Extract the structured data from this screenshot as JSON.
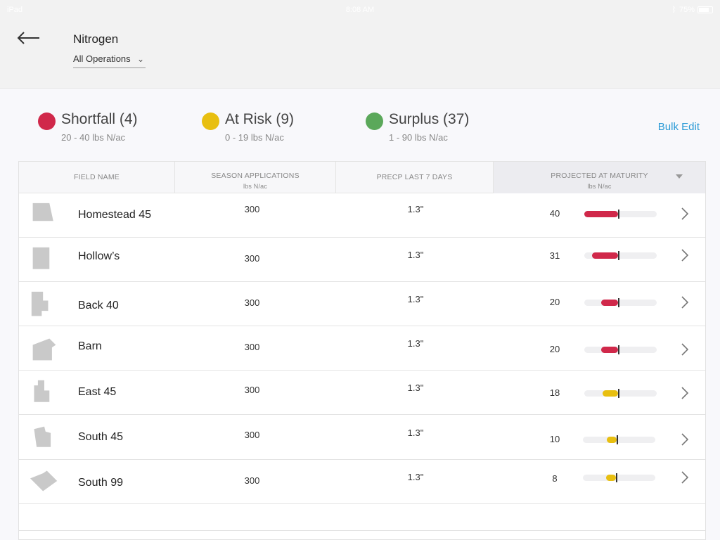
{
  "status_bar": {
    "carrier": "iPad",
    "time": "8:08 AM",
    "battery": "75%"
  },
  "header": {
    "title": "Nitrogen",
    "operations_select": "All Operations"
  },
  "summary": {
    "items": [
      {
        "label": "Shortfall (4)",
        "range": "20 - 40 lbs N/ac",
        "color": "#d0284a"
      },
      {
        "label": "At Risk (9)",
        "range": "0 - 19 lbs N/ac",
        "color": "#e8bf10"
      },
      {
        "label": "Surplus (37)",
        "range": "1 - 90  lbs N/ac",
        "color": "#5ba85a"
      }
    ],
    "bulk_edit": "Bulk Edit"
  },
  "table": {
    "columns": [
      {
        "label": "FIELD NAME",
        "sub": ""
      },
      {
        "label": "SEASON APPLICATIONS",
        "sub": "lbs N/ac"
      },
      {
        "label": "PRECP LAST 7 DAYS",
        "sub": ""
      },
      {
        "label": "PROJECTED AT MATURITY",
        "sub": "lbs N/ac"
      }
    ],
    "rows": [
      {
        "name": "Homestead 45",
        "season": "300",
        "precip": "1.3\"",
        "projected": "40",
        "status": "shortfall",
        "shape": "homestead"
      },
      {
        "name": "Hollow’s",
        "season": "300",
        "precip": "1.3\"",
        "projected": "31",
        "status": "shortfall",
        "shape": "hollows"
      },
      {
        "name": "Back 40",
        "season": "300",
        "precip": "1.3\"",
        "projected": "20",
        "status": "shortfall",
        "shape": "back40"
      },
      {
        "name": "Barn",
        "season": "300",
        "precip": "1.3\"",
        "projected": "20",
        "status": "shortfall",
        "shape": "barn"
      },
      {
        "name": "East 45",
        "season": "300",
        "precip": "1.3\"",
        "projected": "18",
        "status": "at-risk",
        "shape": "east45"
      },
      {
        "name": "South 45",
        "season": "300",
        "precip": "1.3\"",
        "projected": "10",
        "status": "at-risk",
        "shape": "south45"
      },
      {
        "name": "South 99",
        "season": "300",
        "precip": "1.3\"",
        "projected": "8",
        "status": "at-risk",
        "shape": "south99"
      }
    ]
  },
  "colors": {
    "shortfall": "#d0284a",
    "at_risk": "#e8bf10",
    "surplus": "#5ba85a",
    "accent": "#2a9ad6"
  }
}
